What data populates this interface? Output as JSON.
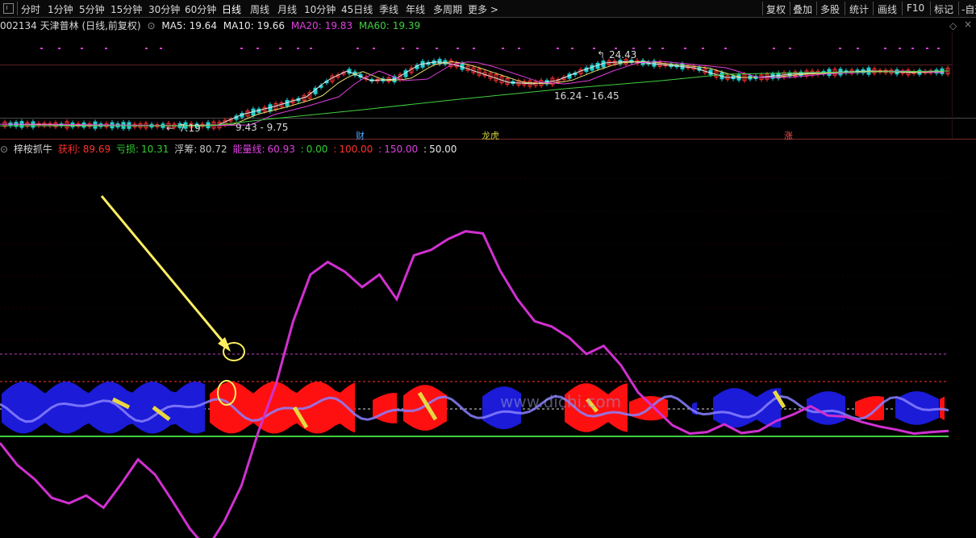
{
  "toolbar": {
    "periods": [
      "分时",
      "1分钟",
      "5分钟",
      "15分钟",
      "30分钟",
      "60分钟",
      "日线",
      "周线",
      "月线",
      "10分钟",
      "45日线",
      "季线",
      "年线",
      "多周期",
      "更多 >"
    ],
    "active_period": "日线",
    "right_buttons": [
      "复权",
      "叠加",
      "多股",
      "统计",
      "画线",
      "F10",
      "标记",
      "-自选"
    ]
  },
  "kline_header": {
    "title": "002134 天津普林 (日线,前复权)",
    "ma": [
      {
        "label": "MA5:",
        "value": "19.64",
        "color": "#e8e8e8"
      },
      {
        "label": "MA10:",
        "value": "19.66",
        "color": "#e8e8e8"
      },
      {
        "label": "MA20:",
        "value": "19.83",
        "color": "#e040e0"
      },
      {
        "label": "MA60:",
        "value": "19.39",
        "color": "#40d040"
      }
    ]
  },
  "kline": {
    "annotations": [
      "24.43",
      "16.24 - 16.45",
      "7.19",
      "9.43 - 9.75"
    ],
    "events": [
      {
        "label": "财",
        "color": "#4aa8ff"
      },
      {
        "label": "龙虎",
        "color": "#d0d040"
      },
      {
        "label": "涨",
        "color": "#ff5050"
      }
    ]
  },
  "indicator": {
    "name": "梓桉抓牛",
    "values": [
      {
        "label": "获利:",
        "value": "89.69",
        "color": "#ff3030"
      },
      {
        "label": "亏损:",
        "value": "10.31",
        "color": "#30d030"
      },
      {
        "label": "浮筹:",
        "value": "80.72",
        "color": "#c8c8c8"
      },
      {
        "label": "能量线:",
        "value": "60.93",
        "color": "#e040e0"
      },
      {
        "label": ":",
        "value": "0.00",
        "color": "#30d030"
      },
      {
        "label": ":",
        "value": "100.00",
        "color": "#ff3030"
      },
      {
        "label": ":",
        "value": "150.00",
        "color": "#e040e0"
      },
      {
        "label": ":",
        "value": "50.00",
        "color": "#e8e8e8"
      }
    ],
    "energy_line": [
      -12,
      -52,
      -78,
      -112,
      -122,
      -108,
      -130,
      -88,
      -42,
      -70,
      -118,
      -168,
      -205,
      -155,
      -90,
      10,
      95,
      210,
      295,
      318,
      300,
      272,
      295,
      250,
      330,
      340,
      360,
      374,
      370,
      302,
      250,
      210,
      200,
      180,
      150,
      165,
      130,
      80,
      50,
      20,
      5,
      8,
      22,
      6,
      10,
      28,
      40,
      55,
      38,
      36,
      26,
      18,
      12,
      5,
      8,
      10
    ]
  },
  "watermark": "www.dichi.com",
  "colors": {
    "up": "#ff3030",
    "down": "#20d0d0",
    "ma5": "#e8e8e8",
    "ma10": "#e8e070",
    "ma20": "#e040e0",
    "ma60": "#40d040",
    "energy": "#d030d0",
    "arrow": "#ffef60"
  }
}
